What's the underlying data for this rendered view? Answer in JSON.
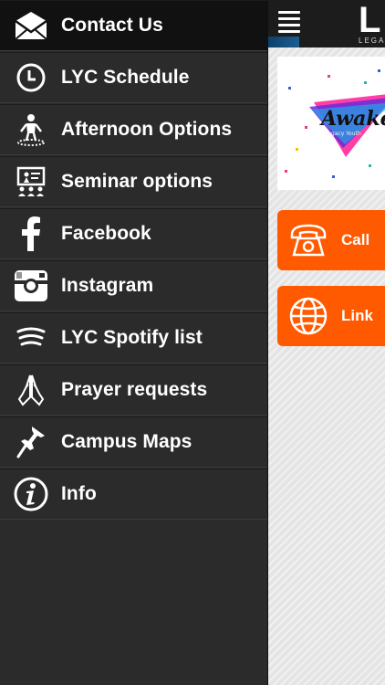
{
  "header": {
    "logo_letter": "L",
    "logo_sub": "LEGA"
  },
  "banner": {
    "title_text": "Awake",
    "subtitle_text": "Legacy Youth"
  },
  "actions": {
    "call_label": "Call",
    "link_label": "Link"
  },
  "colors": {
    "drawer_bg": "#2b2b2b",
    "active_item_bg": "#111111",
    "action_orange": "#ff5a00",
    "topbar": "#1c1c1c"
  },
  "menu": {
    "items": [
      {
        "label": "Contact Us",
        "icon": "envelope-icon"
      },
      {
        "label": "LYC Schedule",
        "icon": "clock-icon"
      },
      {
        "label": "Afternoon Options",
        "icon": "person-podium-icon"
      },
      {
        "label": "Seminar options",
        "icon": "presentation-icon"
      },
      {
        "label": "Facebook",
        "icon": "facebook-icon"
      },
      {
        "label": "Instagram",
        "icon": "instagram-icon"
      },
      {
        "label": "LYC Spotify list",
        "icon": "spotify-icon"
      },
      {
        "label": "Prayer requests",
        "icon": "praying-hands-icon"
      },
      {
        "label": "Campus Maps",
        "icon": "map-pin-icon"
      },
      {
        "label": "Info",
        "icon": "info-icon"
      }
    ]
  }
}
